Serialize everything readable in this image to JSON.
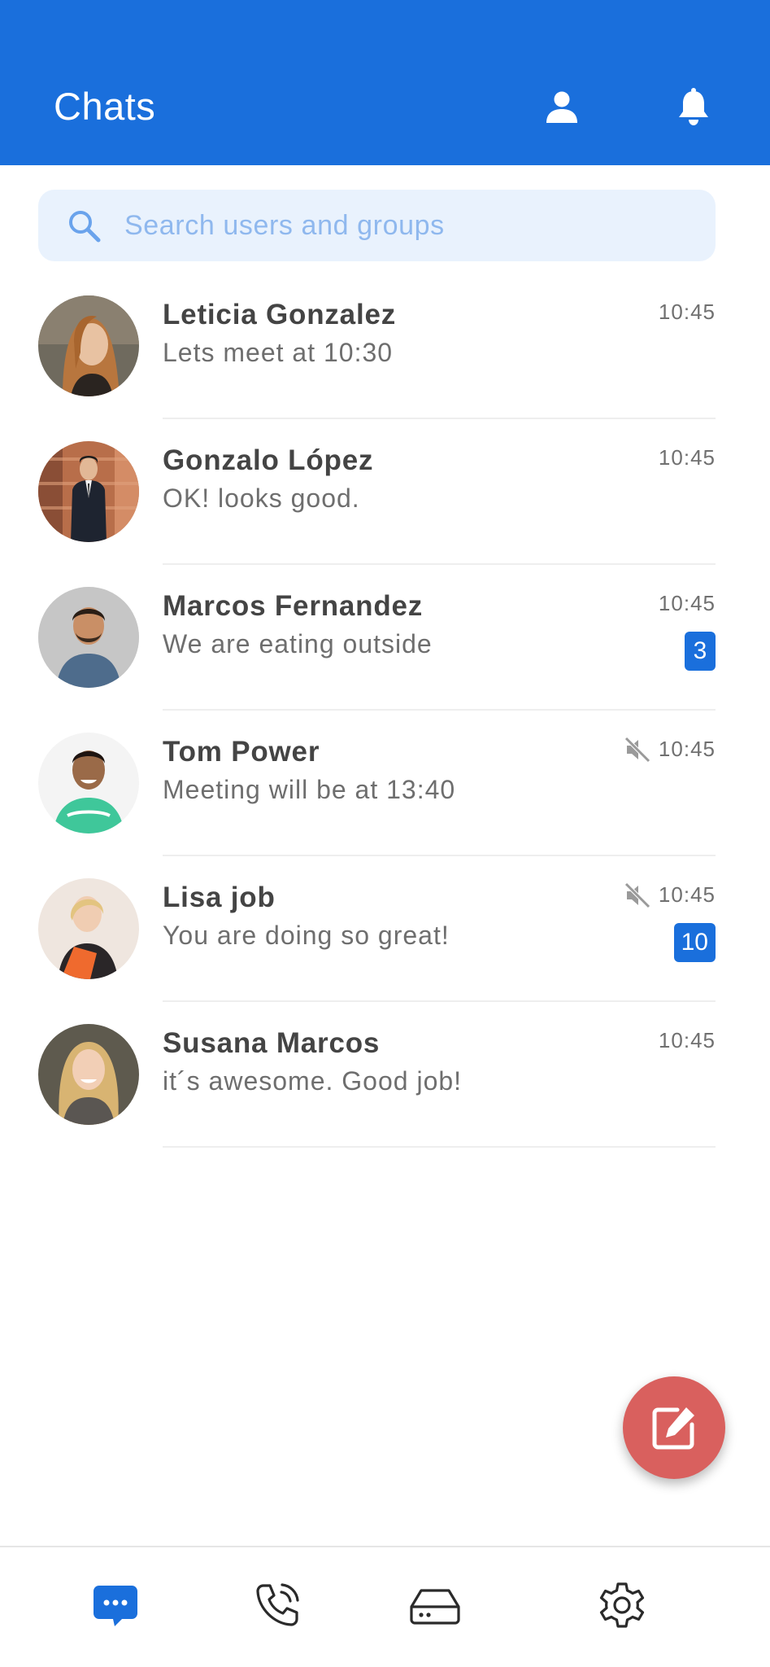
{
  "header": {
    "title": "Chats",
    "background_color": "#1a6fdc",
    "icons": [
      "profile-icon",
      "bell-icon"
    ]
  },
  "search": {
    "placeholder": "Search users and groups"
  },
  "chats": [
    {
      "name": "Leticia Gonzalez",
      "preview": "Lets meet at 10:30",
      "time": "10:45",
      "muted": false,
      "unread": null
    },
    {
      "name": "Gonzalo López",
      "preview": "OK! looks good.",
      "time": "10:45",
      "muted": false,
      "unread": null
    },
    {
      "name": "Marcos Fernandez",
      "preview": "We are eating outside",
      "time": "10:45",
      "muted": false,
      "unread": "3"
    },
    {
      "name": "Tom Power",
      "preview": "Meeting will be at 13:40",
      "time": "10:45",
      "muted": true,
      "unread": null
    },
    {
      "name": "Lisa job",
      "preview": "You are doing so great!",
      "time": "10:45",
      "muted": true,
      "unread": "10"
    },
    {
      "name": "Susana Marcos",
      "preview": "it´s awesome. Good job!",
      "time": "10:45",
      "muted": false,
      "unread": null
    }
  ],
  "fab": {
    "icon": "compose-icon",
    "color": "#d9605e"
  },
  "bottom_nav": {
    "items": [
      {
        "icon": "chat-bubble-icon",
        "active": true
      },
      {
        "icon": "phone-icon",
        "active": false
      },
      {
        "icon": "storage-drive-icon",
        "active": false
      },
      {
        "icon": "gear-icon",
        "active": false
      }
    ],
    "active_color": "#1a6fdc"
  }
}
